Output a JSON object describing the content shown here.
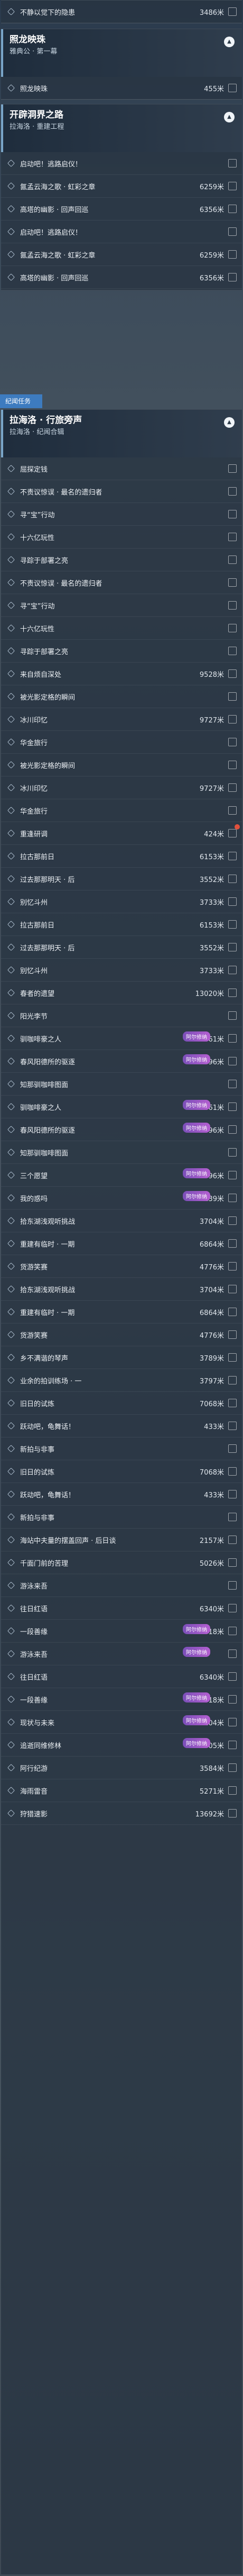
{
  "top_row": {
    "label": "不静以觉下的隐患",
    "value": "3486米"
  },
  "quest1": {
    "title": "照龙映珠",
    "subtitle": "雅典公 · 第一幕",
    "rows": [
      {
        "label": "照龙映珠",
        "value": "455米"
      }
    ]
  },
  "quest2": {
    "title": "开辟洞界之路",
    "subtitle": "拉海洛 · 重建工程",
    "rows": [
      {
        "label": "启动吧！逃路启仪！",
        "value": ""
      },
      {
        "label": "氤孟云海之歌 · 虹彩之章",
        "value": "6259米"
      },
      {
        "label": "高塔的幽影 · 回声回巡",
        "value": "6356米"
      },
      {
        "label": "启动吧！逃路启仪！",
        "value": ""
      },
      {
        "label": "氤孟云海之歌 · 虹彩之章",
        "value": "6259米"
      },
      {
        "label": "高塔的幽影 · 回声回巡",
        "value": "6356米"
      }
    ]
  },
  "tag_label": "纪闻任务",
  "quest3": {
    "title": "拉海洛 · 行旅旁声",
    "subtitle": "拉海洛 · 纪闻合辑",
    "rows": [
      {
        "label": "屈探定钱",
        "value": ""
      },
      {
        "label": "不责议惊误 · 最名的遗归者",
        "value": ""
      },
      {
        "label": "寻“宝”行动",
        "value": ""
      },
      {
        "label": "十六亿玩性",
        "value": ""
      },
      {
        "label": "寻踪于部署之亮",
        "value": ""
      },
      {
        "label": "不责议惊误 · 最名的遗归者",
        "value": ""
      },
      {
        "label": "寻“宝”行动",
        "value": ""
      },
      {
        "label": "十六亿玩性",
        "value": ""
      },
      {
        "label": "寻踪于部署之亮",
        "value": ""
      },
      {
        "label": "来自烦自深处",
        "value": "9528米"
      },
      {
        "label": "被光影定格的瞬间",
        "value": ""
      },
      {
        "label": "冰川印忆",
        "value": "9727米"
      },
      {
        "label": "华金旅行",
        "value": ""
      },
      {
        "label": "被光影定格的瞬间",
        "value": ""
      },
      {
        "label": "冰川印忆",
        "value": "9727米"
      },
      {
        "label": "华金旅行",
        "value": ""
      },
      {
        "label": "重逢研调",
        "value": "424米"
      },
      {
        "label": "拉古那前日",
        "value": "6153米"
      },
      {
        "label": "过去那那明天 · 后",
        "value": "3552米"
      },
      {
        "label": "别忆斗州",
        "value": "3733米"
      },
      {
        "label": "拉古那前日",
        "value": "6153米"
      },
      {
        "label": "过去那那明天 · 后",
        "value": "3552米"
      },
      {
        "label": "别忆斗州",
        "value": "3733米"
      },
      {
        "label": "春者的遗望",
        "value": "13020米"
      },
      {
        "label": "阳光李节",
        "value": ""
      },
      {
        "label": "驯咖啡豪之人",
        "value": "3661米"
      },
      {
        "label": "春风阳德所的驱逐",
        "value": "12996米"
      },
      {
        "label": "知那驯咖啡图面",
        "value": ""
      },
      {
        "label": "驯咖啡豪之人",
        "value": "3661米"
      },
      {
        "label": "春风阳德所的驱逐",
        "value": "12996米"
      },
      {
        "label": "知那驯咖啡图面",
        "value": ""
      },
      {
        "label": "三个愿望",
        "value": "12996米"
      },
      {
        "label": "我的惑吗",
        "value": "13139米"
      },
      {
        "label": "拾东湖浅观听挑战",
        "value": "3704米"
      },
      {
        "label": "重建有临时 · 一期",
        "value": "6864米"
      },
      {
        "label": "货游笑赛",
        "value": "4776米"
      },
      {
        "label": "拾东湖浅观听挑战",
        "value": "3704米"
      },
      {
        "label": "重建有临时 · 一期",
        "value": "6864米"
      },
      {
        "label": "货游笑赛",
        "value": "4776米"
      },
      {
        "label": "乡不满谐的琴声",
        "value": "3789米"
      },
      {
        "label": "业余的拍训练场 · 一",
        "value": "3797米"
      },
      {
        "label": "旧日的试炼",
        "value": "7068米"
      },
      {
        "label": "跃动吧，龟舞话！",
        "value": "433米"
      },
      {
        "label": "新拍与非事",
        "value": ""
      },
      {
        "label": "旧日的试炼",
        "value": "7068米"
      },
      {
        "label": "跃动吧，龟舞话！",
        "value": "433米"
      },
      {
        "label": "新拍与非事",
        "value": ""
      },
      {
        "label": "海站中夫量的摆盖回声 · 后日谈",
        "value": "2157米"
      },
      {
        "label": "千面门前的苦理",
        "value": "5026米"
      },
      {
        "label": "游泳来吾",
        "value": ""
      },
      {
        "label": "往日红语",
        "value": "6340米"
      },
      {
        "label": "一段善缘",
        "value": "13018米"
      },
      {
        "label": "游泳来吾",
        "value": ""
      },
      {
        "label": "往日红语",
        "value": "6340米"
      },
      {
        "label": "一段善缘",
        "value": "13018米"
      },
      {
        "label": "现状与未来",
        "value": "5104米"
      },
      {
        "label": "追逝同维修林",
        "value": "8705米"
      },
      {
        "label": "阿行纪游",
        "value": "3584米"
      },
      {
        "label": "海雨雷音",
        "value": "5271米"
      },
      {
        "label": "狩猎速影",
        "value": "13692米"
      }
    ]
  },
  "badge_text": "阿尔修纳"
}
